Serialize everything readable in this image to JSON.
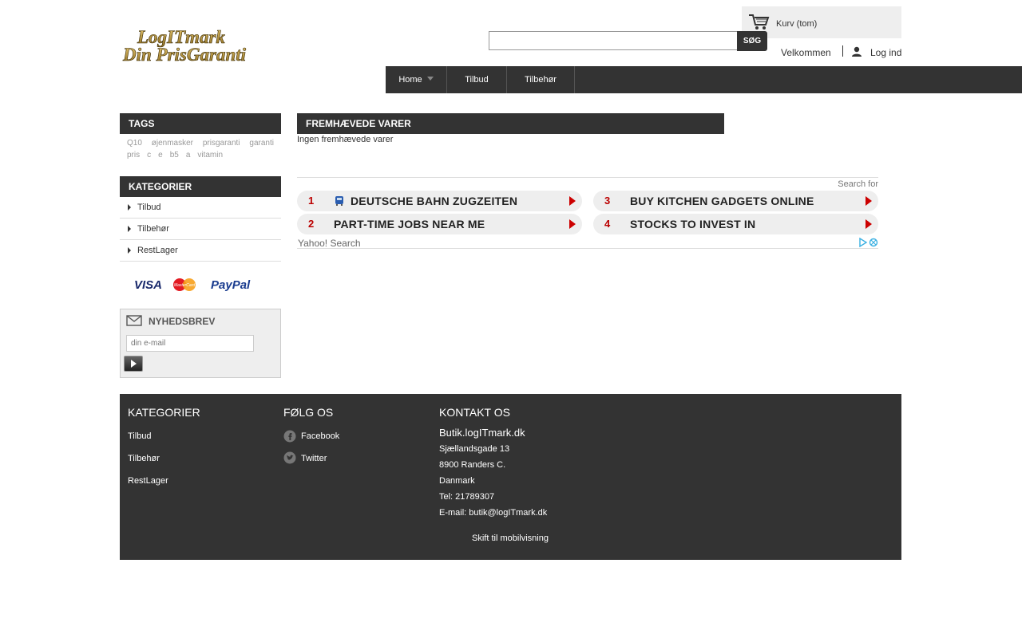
{
  "header": {
    "logo_line1": "LogITmark",
    "logo_line2": "Din PrisGaranti",
    "cart_label": "Kurv (tom)",
    "search_value": "",
    "search_button": "SØG",
    "welcome": "Velkommen",
    "login": "Log ind"
  },
  "nav": {
    "items": [
      {
        "label": "Home"
      },
      {
        "label": "Tilbud"
      },
      {
        "label": "Tilbehør"
      }
    ]
  },
  "sidebar": {
    "tags_title": "TAGS",
    "tags_row1": [
      "Q10",
      "øjenmasker",
      "prisgaranti",
      "garanti"
    ],
    "tags_row2": [
      "pris",
      "c",
      "e",
      "b5",
      "a",
      "vitamin"
    ],
    "categories_title": "KATEGORIER",
    "categories": [
      {
        "label": "Tilbud"
      },
      {
        "label": "Tilbehør"
      },
      {
        "label": "RestLager"
      }
    ],
    "payment_logos": [
      "VISA",
      "MasterCard",
      "PayPal"
    ],
    "newsletter_title": "NYHEDSBREV",
    "newsletter_placeholder": "din e-mail"
  },
  "main": {
    "featured_title": "FREMHÆVEDE VARER",
    "no_items": "Ingen fremhævede varer"
  },
  "ads": {
    "search_for": "Search for",
    "items": [
      {
        "num": "1",
        "text": "DEUTSCHE BAHN ZUGZEITEN"
      },
      {
        "num": "2",
        "text": "PART-TIME JOBS NEAR ME"
      },
      {
        "num": "3",
        "text": "BUY KITCHEN GADGETS ONLINE"
      },
      {
        "num": "4",
        "text": "STOCKS TO INVEST IN"
      }
    ],
    "provider": "Yahoo! Search"
  },
  "footer": {
    "categories_title": "KATEGORIER",
    "categories": [
      "Tilbud",
      "Tilbehør",
      "RestLager"
    ],
    "follow_title": "FØLG OS",
    "follow": [
      "Facebook",
      "Twitter"
    ],
    "contact_title": "KONTAKT OS",
    "shop_name": "Butik.logITmark.dk",
    "address1": "Sjællandsgade 13",
    "address2": "8900 Randers C.",
    "country": "Danmark",
    "phone": "Tel: 21789307",
    "email": "E-mail: butik@logITmark.dk",
    "mobile_link": "Skift til mobilvisning"
  },
  "colors": {
    "dark": "#333333",
    "light_panel": "#eeeeee",
    "ad_accent": "#cc0000"
  }
}
